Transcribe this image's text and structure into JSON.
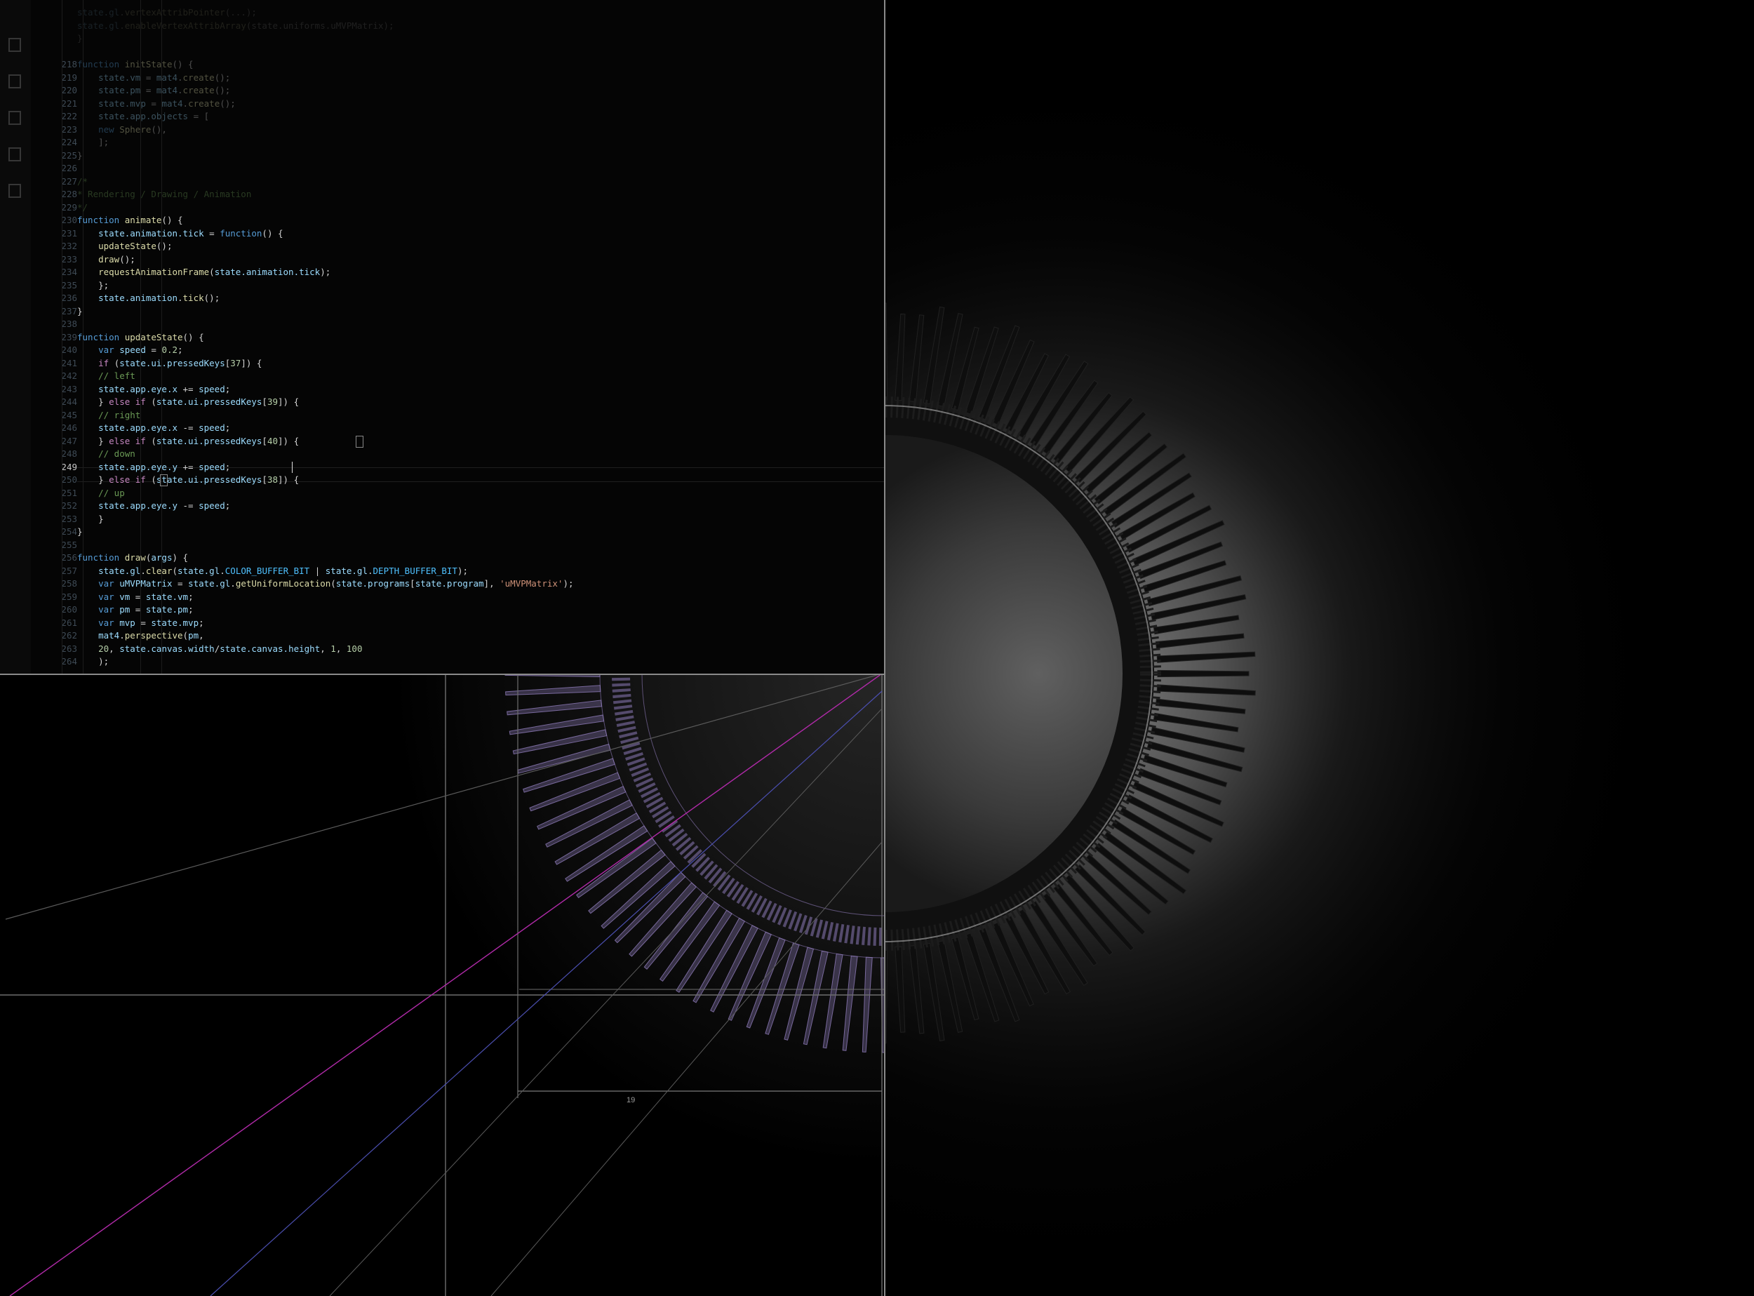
{
  "editor": {
    "activity_icons": [
      "files-icon",
      "search-icon",
      "source-control-icon",
      "run-debug-icon",
      "extensions-icon"
    ],
    "active_line": "249",
    "lines": [
      {
        "n": "",
        "tokens": [
          [
            "tok-var",
            "state.gl"
          ],
          [
            "",
            "."
          ],
          [
            "tok-fn",
            "vertexAttribPointer"
          ],
          [
            "",
            "(...);"
          ]
        ]
      },
      {
        "n": "",
        "tokens": [
          [
            "tok-var",
            "state.gl"
          ],
          [
            "",
            "."
          ],
          [
            "tok-fn",
            "enableVertexAttribArray"
          ],
          [
            "",
            "(state.uniforms.uMVPMatrix);"
          ]
        ]
      },
      {
        "n": "",
        "tokens": [
          [
            "",
            "}"
          ]
        ]
      },
      {
        "n": "",
        "tokens": []
      },
      {
        "n": "218",
        "tokens": [
          [
            "tok-kw",
            "function "
          ],
          [
            "tok-fn",
            "initState"
          ],
          [
            "",
            "() {"
          ]
        ]
      },
      {
        "n": "219",
        "tokens": [
          [
            "",
            "    "
          ],
          [
            "tok-var",
            "state.vm"
          ],
          [
            "",
            " = "
          ],
          [
            "tok-var",
            "mat4"
          ],
          [
            "",
            "."
          ],
          [
            "tok-fn",
            "create"
          ],
          [
            "",
            "();"
          ]
        ]
      },
      {
        "n": "220",
        "tokens": [
          [
            "",
            "    "
          ],
          [
            "tok-var",
            "state.pm"
          ],
          [
            "",
            " = "
          ],
          [
            "tok-var",
            "mat4"
          ],
          [
            "",
            "."
          ],
          [
            "tok-fn",
            "create"
          ],
          [
            "",
            "();"
          ]
        ]
      },
      {
        "n": "221",
        "tokens": [
          [
            "",
            "    "
          ],
          [
            "tok-var",
            "state.mvp"
          ],
          [
            "",
            " = "
          ],
          [
            "tok-var",
            "mat4"
          ],
          [
            "",
            "."
          ],
          [
            "tok-fn",
            "create"
          ],
          [
            "",
            "();"
          ]
        ]
      },
      {
        "n": "222",
        "tokens": [
          [
            "",
            "    "
          ],
          [
            "tok-var",
            "state.app.objects"
          ],
          [
            "",
            " = ["
          ]
        ]
      },
      {
        "n": "223",
        "tokens": [
          [
            "",
            "    "
          ],
          [
            "tok-kw",
            "new "
          ],
          [
            "tok-fn",
            "Sphere"
          ],
          [
            "",
            "(),"
          ]
        ]
      },
      {
        "n": "224",
        "tokens": [
          [
            "",
            "    ];"
          ]
        ]
      },
      {
        "n": "225",
        "tokens": [
          [
            "",
            "}"
          ]
        ]
      },
      {
        "n": "226",
        "tokens": []
      },
      {
        "n": "227",
        "tokens": [
          [
            "tok-cm",
            "/*"
          ]
        ]
      },
      {
        "n": "228",
        "tokens": [
          [
            "tok-cm",
            "* Rendering / Drawing / Animation"
          ]
        ]
      },
      {
        "n": "229",
        "tokens": [
          [
            "tok-cm",
            "*/"
          ]
        ]
      },
      {
        "n": "230",
        "tokens": [
          [
            "tok-kw",
            "function "
          ],
          [
            "tok-fn",
            "animate"
          ],
          [
            "",
            "() {"
          ]
        ]
      },
      {
        "n": "231",
        "tokens": [
          [
            "",
            "    "
          ],
          [
            "tok-var",
            "state.animation.tick"
          ],
          [
            "",
            " = "
          ],
          [
            "tok-kw",
            "function"
          ],
          [
            "",
            "() {"
          ]
        ]
      },
      {
        "n": "232",
        "tokens": [
          [
            "",
            "    "
          ],
          [
            "tok-fn",
            "updateState"
          ],
          [
            "",
            "();"
          ]
        ]
      },
      {
        "n": "233",
        "tokens": [
          [
            "",
            "    "
          ],
          [
            "tok-fn",
            "draw"
          ],
          [
            "",
            "();"
          ]
        ]
      },
      {
        "n": "234",
        "tokens": [
          [
            "",
            "    "
          ],
          [
            "tok-fn",
            "requestAnimationFrame"
          ],
          [
            "",
            "("
          ],
          [
            "tok-var",
            "state.animation.tick"
          ],
          [
            "",
            ");"
          ]
        ]
      },
      {
        "n": "235",
        "tokens": [
          [
            "",
            "    };"
          ]
        ]
      },
      {
        "n": "236",
        "tokens": [
          [
            "",
            "    "
          ],
          [
            "tok-var",
            "state.animation"
          ],
          [
            "",
            "."
          ],
          [
            "tok-fn",
            "tick"
          ],
          [
            "",
            "();"
          ]
        ]
      },
      {
        "n": "237",
        "tokens": [
          [
            "",
            "}"
          ]
        ]
      },
      {
        "n": "238",
        "tokens": []
      },
      {
        "n": "239",
        "tokens": [
          [
            "tok-kw",
            "function "
          ],
          [
            "tok-fn",
            "updateState"
          ],
          [
            "",
            "() {"
          ]
        ]
      },
      {
        "n": "240",
        "tokens": [
          [
            "",
            "    "
          ],
          [
            "tok-kw",
            "var "
          ],
          [
            "tok-var",
            "speed"
          ],
          [
            "",
            " = "
          ],
          [
            "tok-num",
            "0.2"
          ],
          [
            "",
            ";"
          ]
        ]
      },
      {
        "n": "241",
        "tokens": [
          [
            "",
            "    "
          ],
          [
            "tok-kw2",
            "if "
          ],
          [
            "",
            "("
          ],
          [
            "tok-var",
            "state.ui.pressedKeys"
          ],
          [
            "",
            "["
          ],
          [
            "tok-num",
            "37"
          ],
          [
            "",
            "]) {"
          ]
        ]
      },
      {
        "n": "242",
        "tokens": [
          [
            "",
            "    "
          ],
          [
            "tok-cm",
            "// left"
          ]
        ]
      },
      {
        "n": "243",
        "tokens": [
          [
            "",
            "    "
          ],
          [
            "tok-var",
            "state.app.eye.x"
          ],
          [
            "",
            " += "
          ],
          [
            "tok-var",
            "speed"
          ],
          [
            "",
            ";"
          ]
        ]
      },
      {
        "n": "244",
        "tokens": [
          [
            "",
            "    } "
          ],
          [
            "tok-kw2",
            "else if "
          ],
          [
            "",
            "("
          ],
          [
            "tok-var",
            "state.ui.pressedKeys"
          ],
          [
            "",
            "["
          ],
          [
            "tok-num",
            "39"
          ],
          [
            "",
            "]) {"
          ]
        ]
      },
      {
        "n": "245",
        "tokens": [
          [
            "",
            "    "
          ],
          [
            "tok-cm",
            "// right"
          ]
        ]
      },
      {
        "n": "246",
        "tokens": [
          [
            "",
            "    "
          ],
          [
            "tok-var",
            "state.app.eye.x"
          ],
          [
            "",
            " -= "
          ],
          [
            "tok-var",
            "speed"
          ],
          [
            "",
            ";"
          ]
        ]
      },
      {
        "n": "247",
        "tokens": [
          [
            "",
            "    } "
          ],
          [
            "tok-kw2",
            "else if "
          ],
          [
            "",
            "("
          ],
          [
            "tok-var",
            "state.ui.pressedKeys"
          ],
          [
            "",
            "["
          ],
          [
            "tok-num",
            "40"
          ],
          [
            "",
            "]) {"
          ]
        ]
      },
      {
        "n": "248",
        "tokens": [
          [
            "",
            "    "
          ],
          [
            "tok-cm",
            "// down"
          ]
        ]
      },
      {
        "n": "249",
        "tokens": [
          [
            "",
            "    "
          ],
          [
            "tok-var",
            "state.app.eye.y"
          ],
          [
            "",
            " += "
          ],
          [
            "tok-var",
            "speed"
          ],
          [
            "",
            ";"
          ]
        ]
      },
      {
        "n": "250",
        "tokens": [
          [
            "",
            "    } "
          ],
          [
            "tok-kw2",
            "else if "
          ],
          [
            "",
            "("
          ],
          [
            "tok-var",
            "state.ui.pressedKeys"
          ],
          [
            "",
            "["
          ],
          [
            "tok-num",
            "38"
          ],
          [
            "",
            "]) {"
          ]
        ]
      },
      {
        "n": "251",
        "tokens": [
          [
            "",
            "    "
          ],
          [
            "tok-cm",
            "// up"
          ]
        ]
      },
      {
        "n": "252",
        "tokens": [
          [
            "",
            "    "
          ],
          [
            "tok-var",
            "state.app.eye.y"
          ],
          [
            "",
            " -= "
          ],
          [
            "tok-var",
            "speed"
          ],
          [
            "",
            ";"
          ]
        ]
      },
      {
        "n": "253",
        "tokens": [
          [
            "",
            "    }"
          ]
        ]
      },
      {
        "n": "254",
        "tokens": [
          [
            "",
            "}"
          ]
        ]
      },
      {
        "n": "255",
        "tokens": []
      },
      {
        "n": "256",
        "tokens": [
          [
            "tok-kw",
            "function "
          ],
          [
            "tok-fn",
            "draw"
          ],
          [
            "",
            "("
          ],
          [
            "tok-var",
            "args"
          ],
          [
            "",
            ") {"
          ]
        ]
      },
      {
        "n": "257",
        "tokens": [
          [
            "",
            "    "
          ],
          [
            "tok-var",
            "state.gl"
          ],
          [
            "",
            "."
          ],
          [
            "tok-fn",
            "clear"
          ],
          [
            "",
            "("
          ],
          [
            "tok-var",
            "state.gl"
          ],
          [
            "",
            "."
          ],
          [
            "tok-const",
            "COLOR_BUFFER_BIT"
          ],
          [
            "",
            " | "
          ],
          [
            "tok-var",
            "state.gl"
          ],
          [
            "",
            "."
          ],
          [
            "tok-const",
            "DEPTH_BUFFER_BIT"
          ],
          [
            "",
            ");"
          ]
        ]
      },
      {
        "n": "258",
        "tokens": [
          [
            "",
            "    "
          ],
          [
            "tok-kw",
            "var "
          ],
          [
            "tok-var",
            "uMVPMatrix"
          ],
          [
            "",
            " = "
          ],
          [
            "tok-var",
            "state.gl"
          ],
          [
            "",
            "."
          ],
          [
            "tok-fn",
            "getUniformLocation"
          ],
          [
            "",
            "("
          ],
          [
            "tok-var",
            "state.programs"
          ],
          [
            "",
            "["
          ],
          [
            "tok-var",
            "state.program"
          ],
          [
            "",
            "], "
          ],
          [
            "tok-str",
            "'uMVPMatrix'"
          ],
          [
            "",
            ");"
          ]
        ]
      },
      {
        "n": "259",
        "tokens": [
          [
            "",
            "    "
          ],
          [
            "tok-kw",
            "var "
          ],
          [
            "tok-var",
            "vm"
          ],
          [
            "",
            " = "
          ],
          [
            "tok-var",
            "state.vm"
          ],
          [
            "",
            ";"
          ]
        ]
      },
      {
        "n": "260",
        "tokens": [
          [
            "",
            "    "
          ],
          [
            "tok-kw",
            "var "
          ],
          [
            "tok-var",
            "pm"
          ],
          [
            "",
            " = "
          ],
          [
            "tok-var",
            "state.pm"
          ],
          [
            "",
            ";"
          ]
        ]
      },
      {
        "n": "261",
        "tokens": [
          [
            "",
            "    "
          ],
          [
            "tok-kw",
            "var "
          ],
          [
            "tok-var",
            "mvp"
          ],
          [
            "",
            " = "
          ],
          [
            "tok-var",
            "state.mvp"
          ],
          [
            "",
            ";"
          ]
        ]
      },
      {
        "n": "262",
        "tokens": [
          [
            "",
            "    "
          ],
          [
            "tok-var",
            "mat4"
          ],
          [
            "",
            "."
          ],
          [
            "tok-fn",
            "perspective"
          ],
          [
            "",
            "("
          ],
          [
            "tok-var",
            "pm"
          ],
          [
            "",
            ","
          ]
        ]
      },
      {
        "n": "263",
        "tokens": [
          [
            "",
            "    "
          ],
          [
            "tok-num",
            "20"
          ],
          [
            "",
            ", "
          ],
          [
            "tok-var",
            "state.canvas.width"
          ],
          [
            "",
            "/"
          ],
          [
            "tok-var",
            "state.canvas.height"
          ],
          [
            "",
            ", "
          ],
          [
            "tok-num",
            "1"
          ],
          [
            "",
            ", "
          ],
          [
            "tok-num",
            "100"
          ]
        ]
      },
      {
        "n": "264",
        "tokens": [
          [
            "",
            "    );"
          ]
        ]
      }
    ]
  },
  "blueprint": {
    "dimension_label": "19"
  },
  "render": {
    "fin_count": 120,
    "background": "#000000",
    "glow_color": "#8a8a8a",
    "wireframe_color": "#8d7ab8",
    "magenta_line": "#b02aa8",
    "blue_line": "#4b4fb0"
  }
}
